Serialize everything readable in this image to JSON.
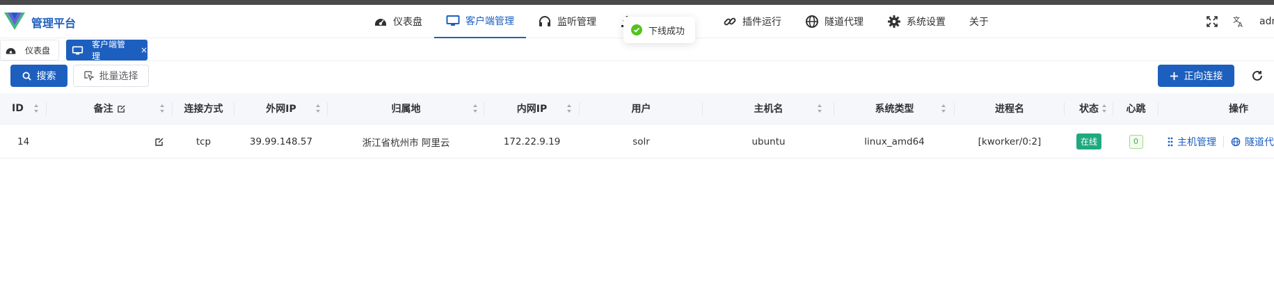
{
  "app": {
    "brand": "管理平台"
  },
  "menu": [
    {
      "label": "仪表盘",
      "icon": "dashboard-icon"
    },
    {
      "label": "客户端管理",
      "icon": "monitor-icon",
      "active": true
    },
    {
      "label": "监听管理",
      "icon": "headphones-icon"
    },
    {
      "label": "",
      "icon": "download-icon"
    },
    {
      "label": "插件运行",
      "icon": "link-icon"
    },
    {
      "label": "隧道代理",
      "icon": "globe-icon"
    },
    {
      "label": "系统设置",
      "icon": "gear-icon"
    },
    {
      "label": "关于",
      "icon": ""
    }
  ],
  "header_right": {
    "user_label": "adm"
  },
  "toast": {
    "message": "下线成功"
  },
  "tabs": [
    {
      "label": "仪表盘"
    },
    {
      "label": "客户端管理",
      "close": "×"
    }
  ],
  "toolbar": {
    "search_label": "搜索",
    "batch_label": "批量选择",
    "connect_label": "正向连接"
  },
  "table": {
    "columns": [
      "ID",
      "备注",
      "连接方式",
      "外网IP",
      "归属地",
      "内网IP",
      "用户",
      "主机名",
      "系统类型",
      "进程名",
      "状态",
      "心跳",
      "操作"
    ],
    "rows": [
      {
        "id": "14",
        "remark": "",
        "protocol": "tcp",
        "public_ip": "39.99.148.57",
        "location": "浙江省杭州市 阿里云",
        "internal_ip": "172.22.9.19",
        "user": "solr",
        "hostname": "ubuntu",
        "os_type": "linux_amd64",
        "process": "[kworker/0:2]",
        "status": "在线",
        "heartbeat": "0",
        "actions": [
          "主机管理",
          "隧道代"
        ]
      }
    ]
  },
  "colors": {
    "primary": "#1d5fbf",
    "online": "#1fa97e",
    "toast_ok": "#52c41a"
  }
}
